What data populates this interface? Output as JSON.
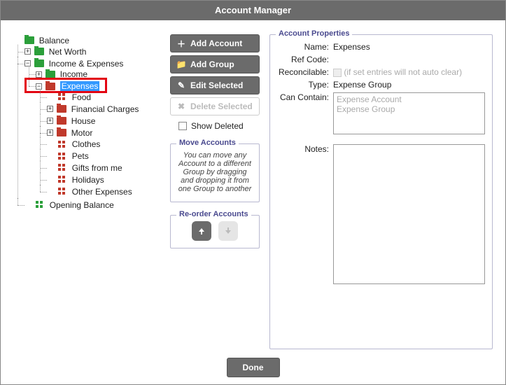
{
  "title": "Account Manager",
  "tree": {
    "root": "Balance",
    "netWorth": "Net Worth",
    "incExp": "Income & Expenses",
    "income": "Income",
    "expenses": "Expenses",
    "food": "Food",
    "financialCharges": "Financial Charges",
    "house": "House",
    "motor": "Motor",
    "clothes": "Clothes",
    "pets": "Pets",
    "gifts": "Gifts from me",
    "holidays": "Holidays",
    "otherExpenses": "Other Expenses",
    "opening": "Opening Balance"
  },
  "actions": {
    "addAccount": "Add Account",
    "addGroup": "Add Group",
    "editSelected": "Edit Selected",
    "deleteSelected": "Delete Selected",
    "showDeleted": "Show Deleted",
    "moveTitle": "Move Accounts",
    "moveText": "You can move any Account to a different Group by dragging and dropping it from one Group to another",
    "reorderTitle": "Re-order Accounts"
  },
  "props": {
    "legend": "Account Properties",
    "nameLabel": "Name:",
    "nameValue": "Expenses",
    "refLabel": "Ref Code:",
    "refValue": "",
    "reconLabel": "Reconcilable:",
    "reconHint": "(if set entries will not auto clear)",
    "typeLabel": "Type:",
    "typeValue": "Expense Group",
    "containLabel": "Can Contain:",
    "containLine1": "Expense Account",
    "containLine2": "Expense Group",
    "notesLabel": "Notes:"
  },
  "footer": {
    "done": "Done"
  }
}
